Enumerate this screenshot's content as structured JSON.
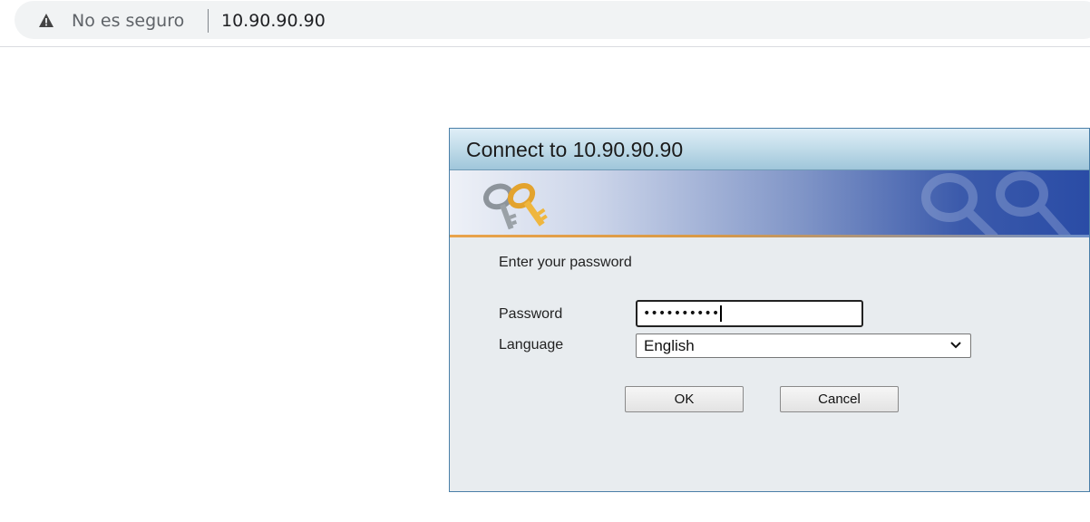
{
  "browser": {
    "security_label": "No es seguro",
    "url": "10.90.90.90",
    "warning_icon": "warning-triangle-icon"
  },
  "dialog": {
    "title": "Connect to 10.90.90.90",
    "prompt": "Enter your password",
    "password_label": "Password",
    "password_value_masked": "••••••••••",
    "language_label": "Language",
    "language_selected": "English",
    "ok_label": "OK",
    "cancel_label": "Cancel",
    "banner_icon": "keys-icon"
  },
  "colors": {
    "title_gradient_top": "#dfeef7",
    "banner_blue": "#2a4ca6",
    "dialog_border": "#4a7fa8"
  }
}
